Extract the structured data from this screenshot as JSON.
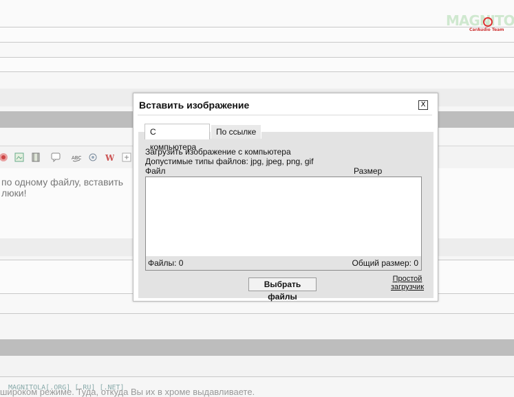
{
  "logo": {
    "text": "MAGNITOLA",
    "tagline": "CarAudio Team"
  },
  "editor": {
    "text_line1": "по одному файлу, вставить",
    "text_line2": "люки!"
  },
  "toolbar_icons": [
    "image-icon",
    "insert-image-icon",
    "film-icon",
    "comment-icon",
    "spellcheck-icon",
    "find-replace-icon",
    "word-paste-icon",
    "add-icon"
  ],
  "footer": {
    "link": "MAGNITOLA[.ORG] [.RU] [.NET]",
    "text": "широком режиме. Туда, откуда Вы их в хроме выдавливаете."
  },
  "dialog": {
    "title": "Вставить изображение",
    "close_label": "X",
    "tabs": [
      {
        "label": "С компьютера",
        "active": true
      },
      {
        "label": "По ссылке",
        "active": false
      }
    ],
    "upload_heading": "Загрузить изображение с компьютера",
    "allowed_types": "Допустимые типы файлов: jpg, jpeg, png, gif",
    "columns": {
      "file": "Файл",
      "size": "Размер"
    },
    "files_count": "Файлы: 0",
    "total_size": "Общий размер: 0",
    "choose_button": "Выбрать файлы",
    "simple_uploader": "Простой загрузчик"
  },
  "colors": {
    "panel_bg": "#e3e3e3",
    "band_dark": "#bdbdbd",
    "page_bg": "#f6f6f6"
  }
}
